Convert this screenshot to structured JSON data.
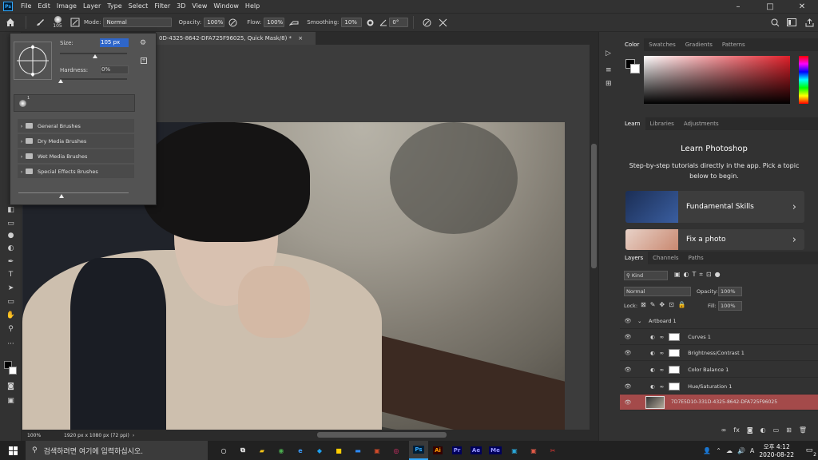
{
  "app": {
    "logo": "Ps"
  },
  "menus": [
    "File",
    "Edit",
    "Image",
    "Layer",
    "Type",
    "Select",
    "Filter",
    "3D",
    "View",
    "Window",
    "Help"
  ],
  "window_controls": {
    "minimize": "–",
    "maximize": "□",
    "close": "✕"
  },
  "options": {
    "brush_size": "105",
    "mode_label": "Mode:",
    "mode_value": "Normal",
    "opacity_label": "Opacity:",
    "opacity_value": "100%",
    "flow_label": "Flow:",
    "flow_value": "100%",
    "smoothing_label": "Smoothing:",
    "smoothing_value": "10%",
    "angle_value": "0°"
  },
  "document": {
    "tab_title": "0D-4325-8642-DFA725F96025, Quick Mask/8) *",
    "tab_close": "×",
    "zoom": "100%",
    "doc_info": "1920 px x 1080 px (72 ppi)"
  },
  "brush_popup": {
    "size_label": "Size:",
    "size_value": "105 px",
    "hardness_label": "Hardness:",
    "hardness_value": "0%",
    "preset_size": "1",
    "folders": [
      "General Brushes",
      "Dry Media Brushes",
      "Wet Media Brushes",
      "Special Effects Brushes"
    ]
  },
  "color_panel": {
    "tabs": [
      "Color",
      "Swatches",
      "Gradients",
      "Patterns"
    ],
    "hue_color": "#e0202a"
  },
  "learn_panel": {
    "tabs": [
      "Learn",
      "Libraries",
      "Adjustments"
    ],
    "title": "Learn Photoshop",
    "description": "Step-by-step tutorials directly in the app. Pick a topic below to begin.",
    "cards": [
      {
        "label": "Fundamental Skills",
        "arrow": "›"
      },
      {
        "label": "Fix a photo",
        "arrow": "›"
      }
    ]
  },
  "layers_panel": {
    "tabs": [
      "Layers",
      "Channels",
      "Paths"
    ],
    "filter_kind": "Kind",
    "blend_mode": "Normal",
    "opacity_label": "Opacity:",
    "opacity_value": "100%",
    "lock_label": "Lock:",
    "fill_label": "Fill:",
    "fill_value": "100%",
    "artboard": "Artboard 1",
    "layers": [
      {
        "name": "Curves 1"
      },
      {
        "name": "Brightness/Contrast 1"
      },
      {
        "name": "Color Balance 1"
      },
      {
        "name": "Hue/Saturation 1"
      },
      {
        "name": "7D7E5D10-331D-4325-8642-DFA725F96025",
        "selected": true
      }
    ],
    "footer_icons": [
      "link-icon",
      "fx-icon",
      "mask-icon",
      "adjustment-icon",
      "group-icon",
      "new-layer-icon",
      "trash-icon"
    ],
    "footer_fx": "fx"
  },
  "taskbar": {
    "search_placeholder": "검색하려면 여기에 입력하십시오.",
    "apps": [
      {
        "label": "Ai",
        "color": "#ff9a00",
        "bg": "#330000"
      },
      {
        "label": "Pr",
        "color": "#9999ff",
        "bg": "#00005b"
      },
      {
        "label": "Ae",
        "color": "#9999ff",
        "bg": "#00005b"
      },
      {
        "label": "Me",
        "color": "#9999ff",
        "bg": "#00005b"
      }
    ],
    "ps_label": "Ps",
    "time": "오후 4:12",
    "date": "2020-08-22",
    "lang": "A",
    "notifications": "2"
  }
}
